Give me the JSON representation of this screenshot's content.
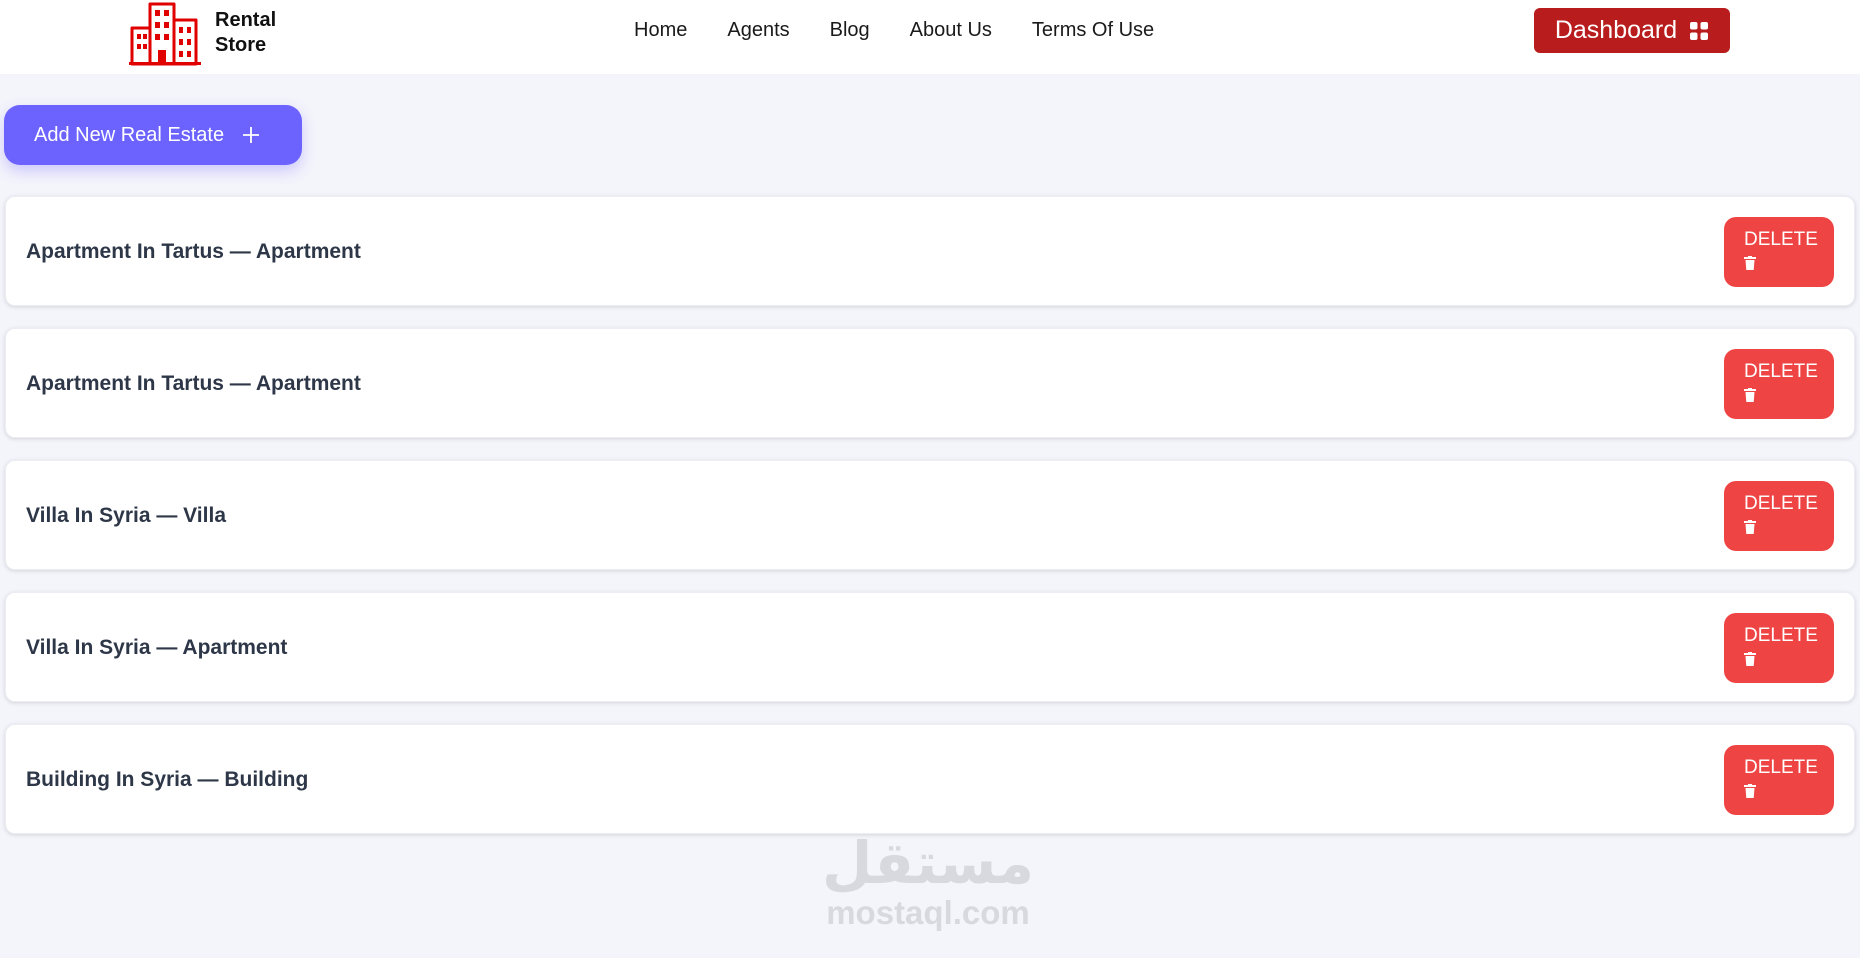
{
  "header": {
    "logo_text": "Rental Store",
    "logo_icon": "buildings-icon",
    "nav": [
      {
        "label": "Home"
      },
      {
        "label": "Agents"
      },
      {
        "label": "Blog"
      },
      {
        "label": "About Us"
      },
      {
        "label": "Terms Of Use"
      }
    ],
    "dashboard_label": "Dashboard",
    "dashboard_icon": "grid-icon"
  },
  "actions": {
    "add_label": "Add New Real Estate",
    "add_icon": "plus-icon"
  },
  "listings": [
    {
      "title": "Apartment In Tartus — Apartment",
      "delete_label": "DELETE"
    },
    {
      "title": "Apartment In Tartus — Apartment",
      "delete_label": "DELETE"
    },
    {
      "title": "Villa In Syria — Villa",
      "delete_label": "DELETE"
    },
    {
      "title": "Villa In Syria — Apartment",
      "delete_label": "DELETE"
    },
    {
      "title": "Building In Syria — Building",
      "delete_label": "DELETE"
    }
  ],
  "watermark": {
    "arabic": "مستقل",
    "latin": "mostaql.com"
  },
  "colors": {
    "brand_red": "#e00000",
    "dashboard_bg": "#b91c1c",
    "accent_purple": "#6c63ff",
    "delete_red": "#ef4444",
    "page_bg": "#f4f4fb"
  }
}
